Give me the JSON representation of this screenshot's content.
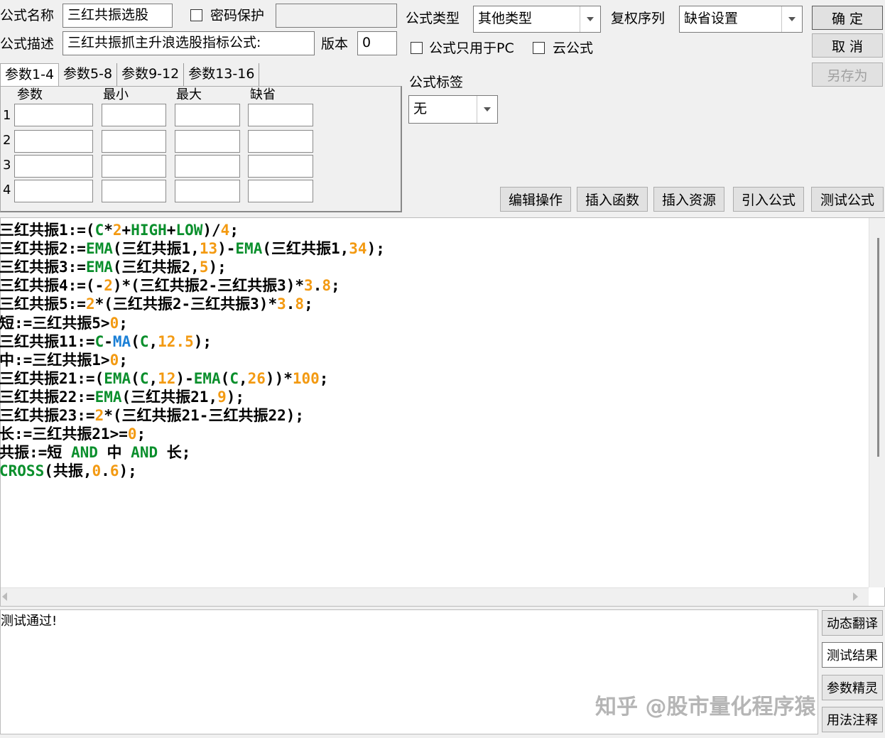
{
  "form": {
    "name_label": "公式名称",
    "name_value": "三红共振选股",
    "password_label": "密码保护",
    "desc_label": "公式描述",
    "desc_value": "三红共振抓主升浪选股指标公式:",
    "version_label": "版本",
    "version_value": "0",
    "type_label": "公式类型",
    "type_value": "其他类型",
    "fuquan_label": "复权序列",
    "fuquan_value": "缺省设置",
    "pc_only_label": "公式只用于PC",
    "cloud_label": "云公式",
    "tag_label": "公式标签",
    "tag_value": "无"
  },
  "buttons": {
    "ok": "确  定",
    "cancel": "取  消",
    "save_as": "另存为",
    "edit_ops": "编辑操作",
    "insert_func": "插入函数",
    "insert_res": "插入资源",
    "import_formula": "引入公式",
    "test_formula": "测试公式"
  },
  "params": {
    "tabs": [
      "参数1-4",
      "参数5-8",
      "参数9-12",
      "参数13-16"
    ],
    "headers": [
      "参数",
      "最小",
      "最大",
      "缺省"
    ],
    "rows": [
      "1",
      "2",
      "3",
      "4"
    ]
  },
  "code": [
    [
      [
        "三红共振1:=(",
        ""
      ],
      [
        "C",
        "g"
      ],
      [
        "*",
        ""
      ],
      [
        "2",
        "o"
      ],
      [
        "+",
        ""
      ],
      [
        "HIGH",
        "g"
      ],
      [
        "+",
        ""
      ],
      [
        "LOW",
        "g"
      ],
      [
        ")/",
        ""
      ],
      [
        "4",
        "o"
      ],
      [
        ";",
        ""
      ]
    ],
    [
      [
        "三红共振2:=",
        ""
      ],
      [
        "EMA",
        "g"
      ],
      [
        "(三红共振1,",
        ""
      ],
      [
        "13",
        "o"
      ],
      [
        ")-",
        ""
      ],
      [
        "EMA",
        "g"
      ],
      [
        "(三红共振1,",
        ""
      ],
      [
        "34",
        "o"
      ],
      [
        ");",
        ""
      ]
    ],
    [
      [
        "三红共振3:=",
        ""
      ],
      [
        "EMA",
        "g"
      ],
      [
        "(三红共振2,",
        ""
      ],
      [
        "5",
        "o"
      ],
      [
        ");",
        ""
      ]
    ],
    [
      [
        "三红共振4:=(-",
        ""
      ],
      [
        "2",
        "o"
      ],
      [
        ")*(三红共振2-三红共振3)*",
        ""
      ],
      [
        "3",
        "o"
      ],
      [
        ".",
        ""
      ],
      [
        "8",
        "o"
      ],
      [
        ";",
        ""
      ]
    ],
    [
      [
        "三红共振5:=",
        ""
      ],
      [
        "2",
        "o"
      ],
      [
        "*(三红共振2-三红共振3)*",
        ""
      ],
      [
        "3",
        "o"
      ],
      [
        ".",
        ""
      ],
      [
        "8",
        "o"
      ],
      [
        ";",
        ""
      ]
    ],
    [
      [
        "短:=三红共振5>",
        ""
      ],
      [
        "0",
        "o"
      ],
      [
        ";",
        ""
      ]
    ],
    [
      [
        "三红共振11:=",
        ""
      ],
      [
        "C",
        "g"
      ],
      [
        "-",
        ""
      ],
      [
        "MA",
        "b"
      ],
      [
        "(",
        ""
      ],
      [
        "C",
        "g"
      ],
      [
        ",",
        ""
      ],
      [
        "12.5",
        "o"
      ],
      [
        ");",
        ""
      ]
    ],
    [
      [
        "中:=三红共振1>",
        ""
      ],
      [
        "0",
        "o"
      ],
      [
        ";",
        ""
      ]
    ],
    [
      [
        "三红共振21:=(",
        ""
      ],
      [
        "EMA",
        "g"
      ],
      [
        "(",
        ""
      ],
      [
        "C",
        "g"
      ],
      [
        ",",
        ""
      ],
      [
        "12",
        "o"
      ],
      [
        ")-",
        ""
      ],
      [
        "EMA",
        "g"
      ],
      [
        "(",
        ""
      ],
      [
        "C",
        "g"
      ],
      [
        ",",
        ""
      ],
      [
        "26",
        "o"
      ],
      [
        "))*",
        ""
      ],
      [
        "100",
        "o"
      ],
      [
        ";",
        ""
      ]
    ],
    [
      [
        "三红共振22:=",
        ""
      ],
      [
        "EMA",
        "g"
      ],
      [
        "(三红共振21,",
        ""
      ],
      [
        "9",
        "o"
      ],
      [
        ");",
        ""
      ]
    ],
    [
      [
        "三红共振23:=",
        ""
      ],
      [
        "2",
        "o"
      ],
      [
        "*(三红共振21-三红共振22);",
        ""
      ]
    ],
    [
      [
        "长:=三红共振21>=",
        ""
      ],
      [
        "0",
        "o"
      ],
      [
        ";",
        ""
      ]
    ],
    [
      [
        "共振:=短 ",
        ""
      ],
      [
        "AND",
        "g"
      ],
      [
        " 中 ",
        ""
      ],
      [
        "AND",
        "g"
      ],
      [
        " 长;",
        ""
      ]
    ],
    [
      [
        "CROSS",
        "g"
      ],
      [
        "(共振,",
        ""
      ],
      [
        "0",
        "o"
      ],
      [
        ".",
        ""
      ],
      [
        "6",
        "o"
      ],
      [
        ");",
        ""
      ]
    ]
  ],
  "output": {
    "text": "测试通过!",
    "side_buttons": [
      "动态翻译",
      "测试结果",
      "参数精灵",
      "用法注释"
    ]
  },
  "watermark": "知乎 @股市量化程序猿",
  "colors": {
    "keyword": "#0a8f2c",
    "function_blue": "#1a7fd6",
    "number": "#f39a12"
  }
}
